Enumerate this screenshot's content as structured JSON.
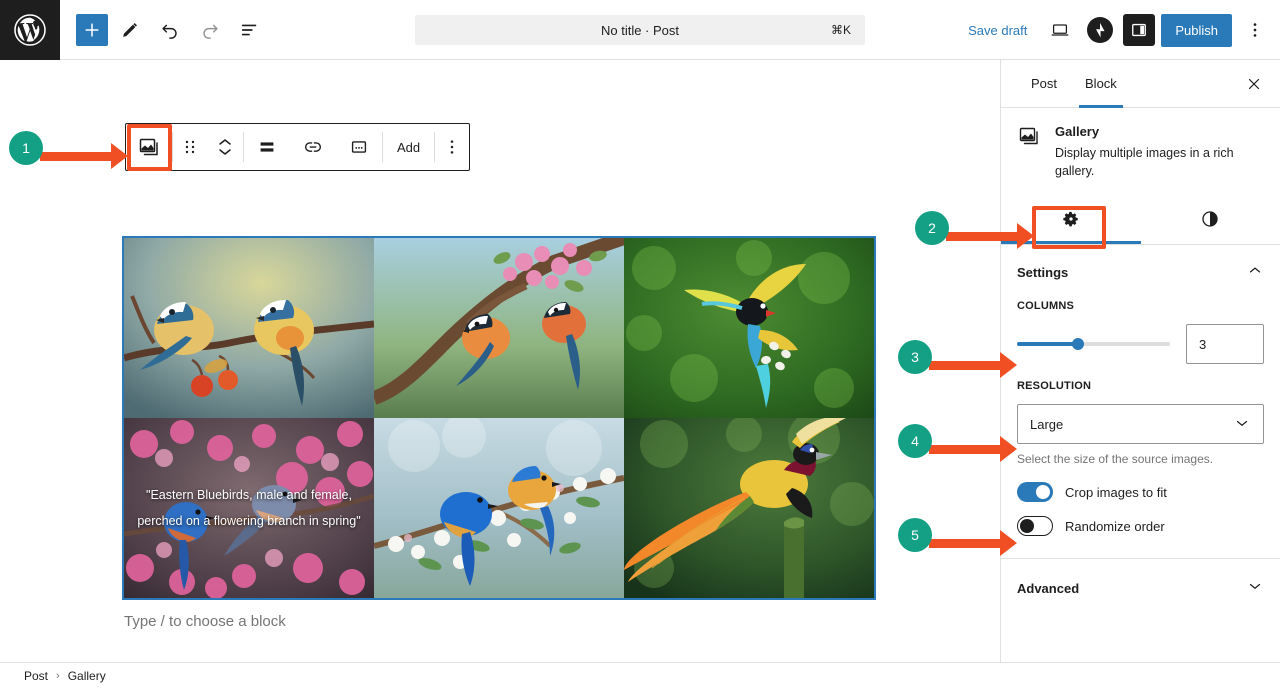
{
  "header": {
    "logo_icon": "wordpress-logo",
    "add_block_icon": "plus-icon",
    "edit_icon": "pencil-icon",
    "undo_icon": "undo-icon",
    "redo_icon": "redo-icon",
    "list_view_icon": "list-view-icon",
    "command_bar": {
      "title": "No title · Post",
      "shortcut": "⌘K"
    },
    "save_draft_label": "Save draft",
    "preview_icon": "desktop-preview-icon",
    "jetpack_icon": "jetpack-icon",
    "settings_toggle_icon": "sidebar-toggle-icon",
    "publish_label": "Publish",
    "more_menu_icon": "ellipsis-vertical-icon"
  },
  "block_toolbar": {
    "block_type_icon": "gallery-block-icon",
    "drag_handle_icon": "drag-handle-icon",
    "move_up_icon": "chevron-up-icon",
    "move_down_icon": "chevron-down-icon",
    "align_icon": "align-icon",
    "link_icon": "link-icon",
    "caption_icon": "caption-icon",
    "add_label": "Add",
    "options_icon": "ellipsis-vertical-icon"
  },
  "canvas": {
    "gallery": {
      "columns": 3,
      "images": [
        {
          "alt": "Two blue tit birds perched on a branch with red berries",
          "caption": ""
        },
        {
          "alt": "Two colorful birds on a blossoming branch",
          "caption": ""
        },
        {
          "alt": "Green and yellow bird flying in front of foliage",
          "caption": ""
        },
        {
          "alt": "Eastern bluebird pair on pink flowering branch",
          "caption": "\"Eastern Bluebirds, male and female, perched on a flowering branch in spring\""
        },
        {
          "alt": "Two bluebirds on a white blossom branch",
          "caption": ""
        },
        {
          "alt": "Bird of paradise with long orange plumes on a stump",
          "caption": ""
        }
      ]
    },
    "empty_paragraph_placeholder": "Type / to choose a block"
  },
  "sidebar": {
    "tabs": [
      {
        "label": "Post",
        "active": false
      },
      {
        "label": "Block",
        "active": true
      }
    ],
    "close_icon": "close-icon",
    "block_card": {
      "icon": "gallery-block-icon",
      "title": "Gallery",
      "description": "Display multiple images in a rich gallery."
    },
    "panel_tabs": [
      {
        "icon": "gear-icon",
        "active": true
      },
      {
        "icon": "styles-contrast-icon",
        "active": false
      }
    ],
    "settings": {
      "title": "Settings",
      "collapse_icon": "chevron-up-icon",
      "columns": {
        "label": "Columns",
        "value": "3",
        "slider_percent": 40
      },
      "resolution": {
        "label": "Resolution",
        "value": "Large",
        "chevron_icon": "chevron-down-icon",
        "help": "Select the size of the source images."
      },
      "toggles": [
        {
          "label": "Crop images to fit",
          "on": true
        },
        {
          "label": "Randomize order",
          "on": false
        }
      ]
    },
    "advanced": {
      "label": "Advanced",
      "chevron_icon": "chevron-down-icon"
    }
  },
  "footer": {
    "breadcrumb": [
      "Post",
      "Gallery"
    ],
    "separator": "›"
  },
  "annotations": {
    "badges": [
      {
        "number": "1"
      },
      {
        "number": "2"
      },
      {
        "number": "3"
      },
      {
        "number": "4"
      },
      {
        "number": "5"
      }
    ],
    "badge_color": "#13a085",
    "arrow_color": "#f04e23",
    "highlight_color": "#f04e23"
  }
}
